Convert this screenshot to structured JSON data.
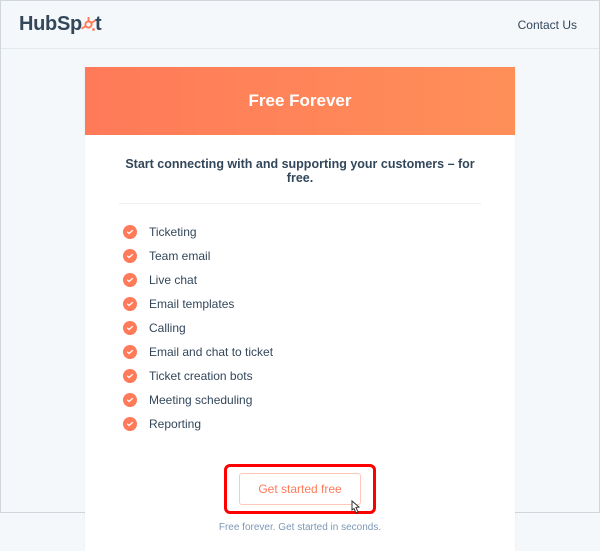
{
  "header": {
    "brand_part1": "Hub",
    "brand_part2": "Sp",
    "brand_part3": "t",
    "contact_label": "Contact Us"
  },
  "card": {
    "title": "Free Forever",
    "tagline": "Start connecting with and supporting your customers – for free.",
    "features": [
      "Ticketing",
      "Team email",
      "Live chat",
      "Email templates",
      "Calling",
      "Email and chat to ticket",
      "Ticket creation bots",
      "Meeting scheduling",
      "Reporting"
    ],
    "cta_label": "Get started free",
    "subnote": "Free forever. Get started in seconds."
  }
}
